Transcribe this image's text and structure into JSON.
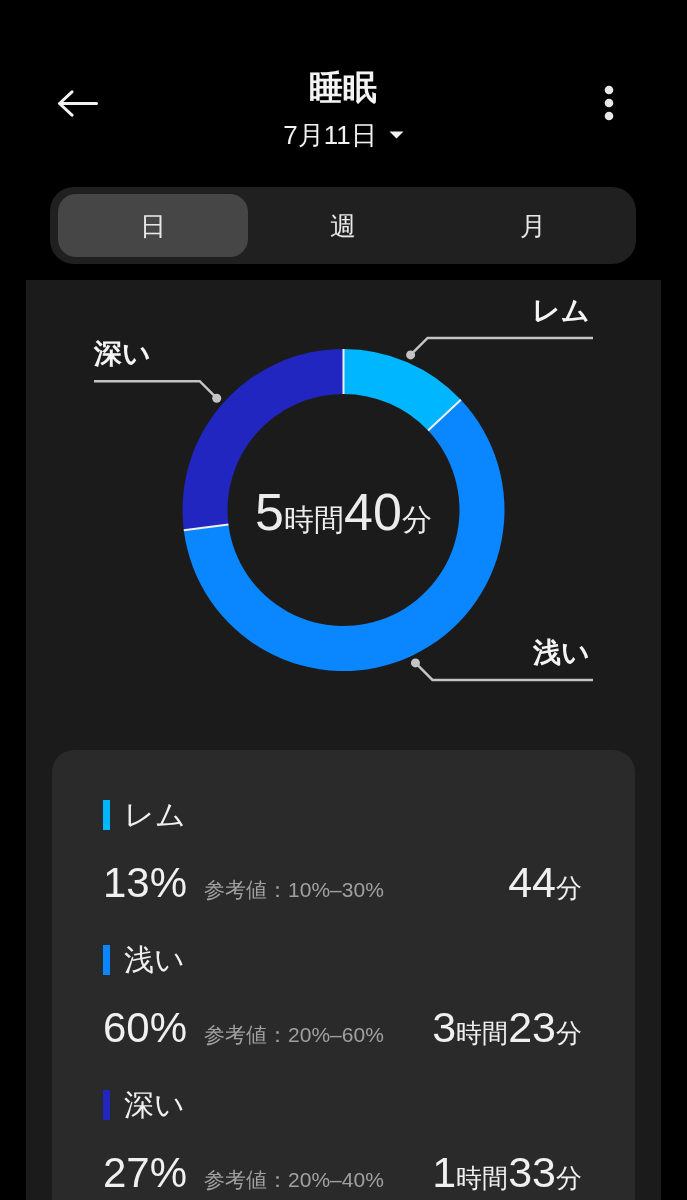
{
  "header": {
    "title": "睡眠",
    "date": "7月11日"
  },
  "tabs": [
    {
      "label": "日",
      "selected": true
    },
    {
      "label": "週",
      "selected": false
    },
    {
      "label": "月",
      "selected": false
    }
  ],
  "chart": {
    "total": "5時間40分",
    "chart_data": {
      "type": "donut",
      "categories": [
        "レム",
        "浅い",
        "深い"
      ],
      "values": [
        13,
        60,
        27
      ]
    }
  },
  "stages": [
    {
      "label": "レム",
      "color": "#00b6ff",
      "percent": "13%",
      "reference": "参考値：10%–30%",
      "duration": "44分"
    },
    {
      "label": "浅い",
      "color": "#0a86ff",
      "percent": "60%",
      "reference": "参考値：20%–60%",
      "duration": "3時間23分"
    },
    {
      "label": "深い",
      "color": "#2226c0",
      "percent": "27%",
      "reference": "参考値：20%–40%",
      "duration": "1時間33分"
    }
  ]
}
